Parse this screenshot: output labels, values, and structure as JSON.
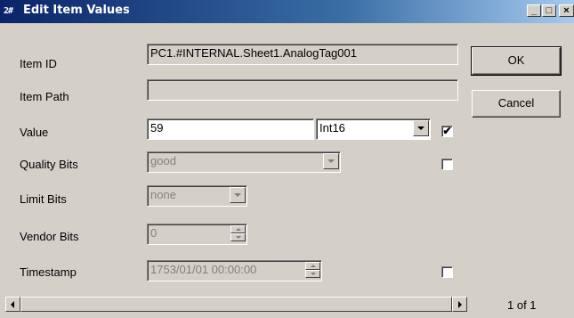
{
  "window": {
    "title": "Edit Item Values",
    "icon_text": "2#",
    "controls": {
      "minimize": "_",
      "maximize": "□",
      "close": "×"
    }
  },
  "labels": {
    "item_id": "Item ID",
    "item_path": "Item Path",
    "value": "Value",
    "quality_bits": "Quality Bits",
    "limit_bits": "Limit Bits",
    "vendor_bits": "Vendor Bits",
    "timestamp": "Timestamp"
  },
  "fields": {
    "item_id": "PC1.#INTERNAL.Sheet1.AnalogTag001",
    "item_path": "",
    "value": "59",
    "value_type": "Int16",
    "quality_bits": "good",
    "limit_bits": "none",
    "vendor_bits": "0",
    "timestamp": "1753/01/01 00:00:00"
  },
  "checkboxes": {
    "value_checked": true,
    "quality_checked": false,
    "timestamp_checked": false,
    "check_glyph": "✔"
  },
  "buttons": {
    "ok": "OK",
    "cancel": "Cancel"
  },
  "pager": {
    "label": "1 of 1"
  }
}
